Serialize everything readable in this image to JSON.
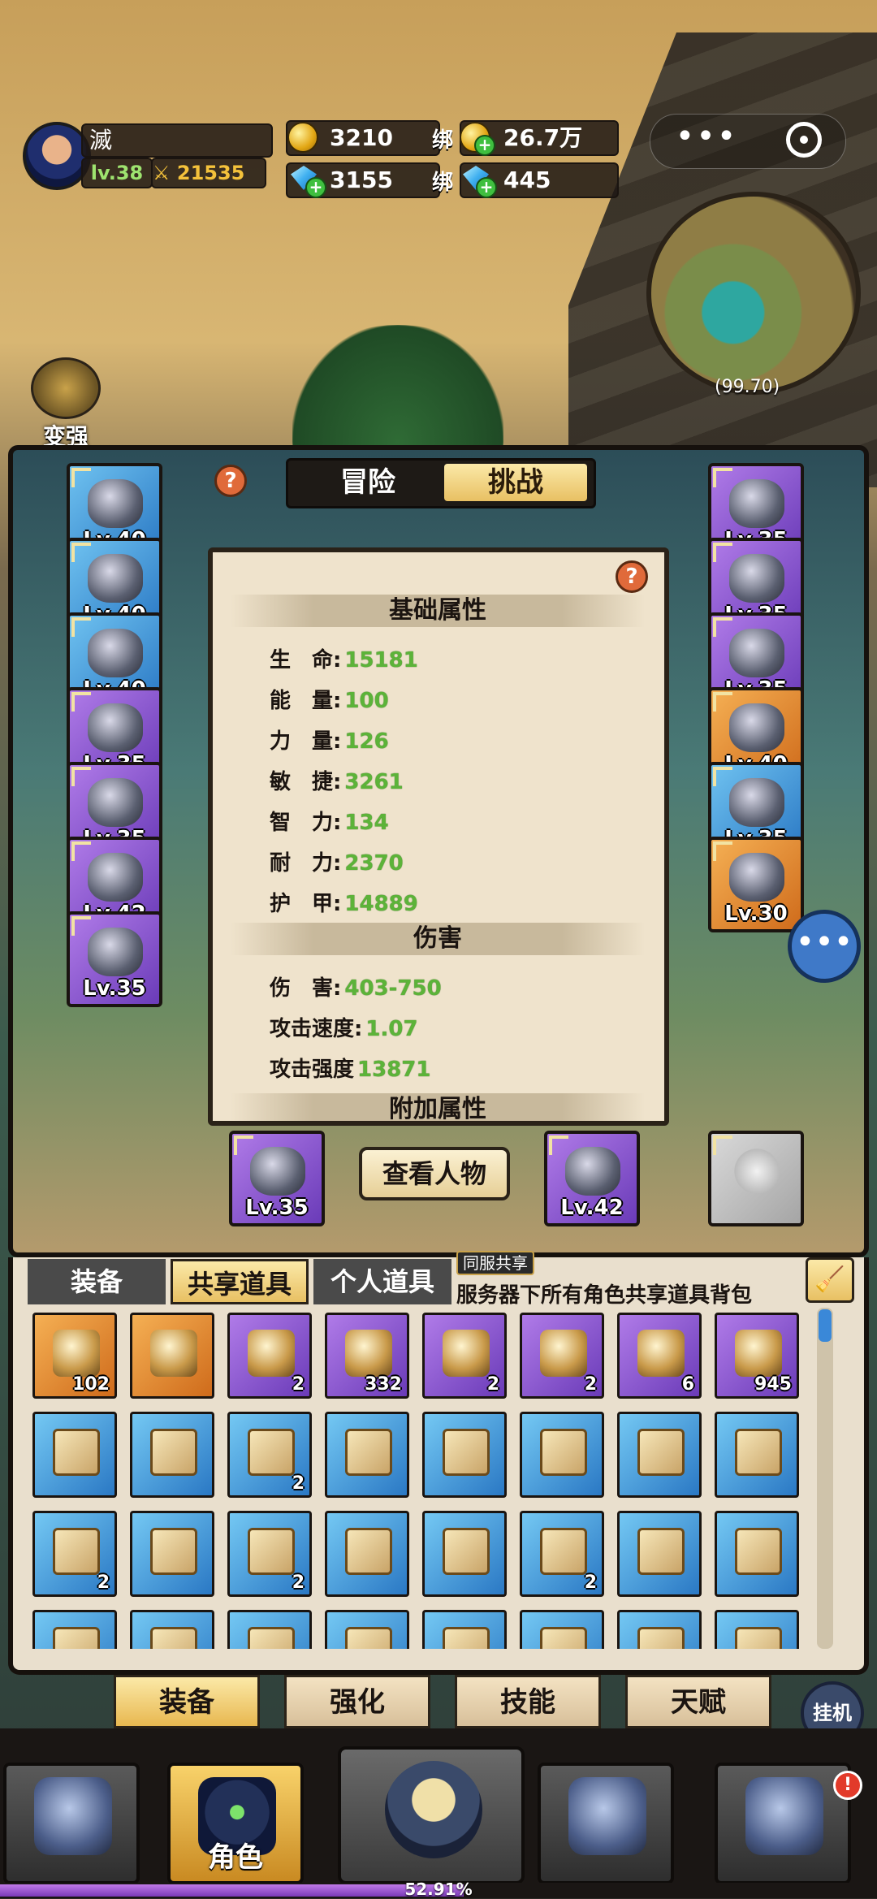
{
  "hud": {
    "player_name": "滅",
    "level": "lv.38",
    "combat_power": "21535",
    "gold": "3210",
    "bound_label": "绑",
    "bound_gold": "26.7万",
    "diamonds": "3155",
    "bound_diamonds": "445",
    "menu_dots": "•••",
    "map_coords": "(99.70)",
    "strengthen_label": "变强"
  },
  "mode_tabs": {
    "adventure": "冒险",
    "challenge": "挑战",
    "active": "challenge"
  },
  "help_icon": "?",
  "equipment": {
    "left": [
      {
        "level": "Lv.40",
        "rarity": "blue",
        "icon": "helmet-icon"
      },
      {
        "level": "Lv.40",
        "rarity": "blue",
        "icon": "necklace-icon"
      },
      {
        "level": "Lv.40",
        "rarity": "blue",
        "icon": "shoulder-icon"
      },
      {
        "level": "Lv.35",
        "rarity": "purple",
        "icon": "chest-armor-icon"
      },
      {
        "level": "Lv.35",
        "rarity": "purple",
        "icon": "cloak-icon"
      },
      {
        "level": "Lv.42",
        "rarity": "purple",
        "icon": "bracer-icon"
      },
      {
        "level": "Lv.35",
        "rarity": "purple",
        "icon": "gauntlet-icon"
      }
    ],
    "right": [
      {
        "level": "Lv.35",
        "rarity": "purple",
        "icon": "belt-icon"
      },
      {
        "level": "Lv.35",
        "rarity": "purple",
        "icon": "pants-icon"
      },
      {
        "level": "Lv.35",
        "rarity": "purple",
        "icon": "boots-icon"
      },
      {
        "level": "Lv.40",
        "rarity": "orange",
        "icon": "ring-icon"
      },
      {
        "level": "Lv.35",
        "rarity": "blue",
        "icon": "gear-ring-icon"
      },
      {
        "level": "Lv.30",
        "rarity": "orange",
        "icon": "amulet-icon"
      }
    ],
    "weapons": [
      {
        "level": "Lv.35",
        "rarity": "purple",
        "icon": "dagger-icon"
      },
      {
        "level": "Lv.42",
        "rarity": "purple",
        "icon": "sword-icon"
      },
      {
        "level": "",
        "rarity": "gray",
        "icon": "empty-slot-icon"
      }
    ]
  },
  "stats": {
    "basic_title": "基础属性",
    "basic": [
      {
        "label": "生　命:",
        "value": "15181"
      },
      {
        "label": "能　量:",
        "value": "100"
      },
      {
        "label": "力　量:",
        "value": "126"
      },
      {
        "label": "敏　捷:",
        "value": "3261"
      },
      {
        "label": "智　力:",
        "value": "134"
      },
      {
        "label": "耐　力:",
        "value": "2370"
      },
      {
        "label": "护　甲:",
        "value": "14889"
      }
    ],
    "damage_title": "伤害",
    "damage": [
      {
        "label": "伤　害:",
        "value": "403-750"
      },
      {
        "label": "攻击速度:",
        "value": "1.07"
      },
      {
        "label": "攻击强度",
        "value": "13871"
      }
    ],
    "extra_title": "附加属性"
  },
  "view_character": "查看人物",
  "chat_icon": "•••",
  "bag": {
    "tabs": [
      "装备",
      "共享道具",
      "个人道具"
    ],
    "active_tab": "共享道具",
    "server_badge": "同服共享",
    "description": "服务器下所有角色共享道具背包",
    "broom_icon": "🧹",
    "rows": [
      [
        {
          "rarity": "orange",
          "count": "102",
          "icon": "treasure-bag-icon"
        },
        {
          "rarity": "orange",
          "count": "",
          "icon": "water-drop-icon"
        },
        {
          "rarity": "purple",
          "count": "2",
          "icon": "sun-scroll-icon"
        },
        {
          "rarity": "purple",
          "count": "332",
          "icon": "crystal-cluster-icon"
        },
        {
          "rarity": "purple",
          "count": "2",
          "icon": "treasure-chest-icon"
        },
        {
          "rarity": "purple",
          "count": "2",
          "icon": "red-gem-icon"
        },
        {
          "rarity": "purple",
          "count": "6",
          "icon": "clover-coin-icon"
        },
        {
          "rarity": "purple",
          "count": "945",
          "icon": "blue-ore-icon"
        }
      ],
      [
        {
          "rarity": "blue",
          "count": "",
          "icon": "bracer-scroll-icon"
        },
        {
          "rarity": "blue",
          "count": "",
          "icon": "helmet-scroll-icon"
        },
        {
          "rarity": "blue",
          "count": "2",
          "icon": "staff-scroll-icon"
        },
        {
          "rarity": "blue",
          "count": "",
          "icon": "bow-scroll-icon"
        },
        {
          "rarity": "blue",
          "count": "",
          "icon": "sword-scroll-icon"
        },
        {
          "rarity": "blue",
          "count": "",
          "icon": "spear-scroll-icon"
        },
        {
          "rarity": "blue",
          "count": "",
          "icon": "cleaver-scroll-icon"
        },
        {
          "rarity": "blue",
          "count": "",
          "icon": "cloak-scroll-icon"
        }
      ],
      [
        {
          "rarity": "blue",
          "count": "2",
          "icon": "shoulder-scroll-icon"
        },
        {
          "rarity": "blue",
          "count": "",
          "icon": "card-scroll-icon"
        },
        {
          "rarity": "blue",
          "count": "2",
          "icon": "axe-scroll-icon"
        },
        {
          "rarity": "blue",
          "count": "",
          "icon": "ring-scroll-icon"
        },
        {
          "rarity": "blue",
          "count": "",
          "icon": "bracer2-scroll-icon"
        },
        {
          "rarity": "blue",
          "count": "2",
          "icon": "armor-scroll-icon"
        },
        {
          "rarity": "blue",
          "count": "",
          "icon": "scimitar-scroll-icon"
        },
        {
          "rarity": "blue",
          "count": "",
          "icon": "tunic-scroll-icon"
        }
      ],
      [
        {
          "rarity": "blue",
          "count": "",
          "icon": "scroll-icon"
        },
        {
          "rarity": "blue",
          "count": "",
          "icon": "scroll-icon"
        },
        {
          "rarity": "blue",
          "count": "",
          "icon": "scroll-icon"
        },
        {
          "rarity": "blue",
          "count": "",
          "icon": "scroll-icon"
        },
        {
          "rarity": "blue",
          "count": "",
          "icon": "scroll-icon"
        },
        {
          "rarity": "blue",
          "count": "",
          "icon": "scroll-icon"
        },
        {
          "rarity": "blue",
          "count": "",
          "icon": "scroll-icon"
        },
        {
          "rarity": "blue",
          "count": "",
          "icon": "scroll-icon"
        }
      ]
    ]
  },
  "sub_tabs": [
    "装备",
    "强化",
    "技能",
    "天赋"
  ],
  "idle_label": "挂机",
  "nav": {
    "role_label": "角色",
    "badge": "!",
    "xp_percent": 52.91,
    "xp_text": "52.91%"
  },
  "colors": {
    "accent_gold": "#e8c063",
    "stat_green": "#5cb339",
    "xp_purple": "#7a3ab8"
  }
}
